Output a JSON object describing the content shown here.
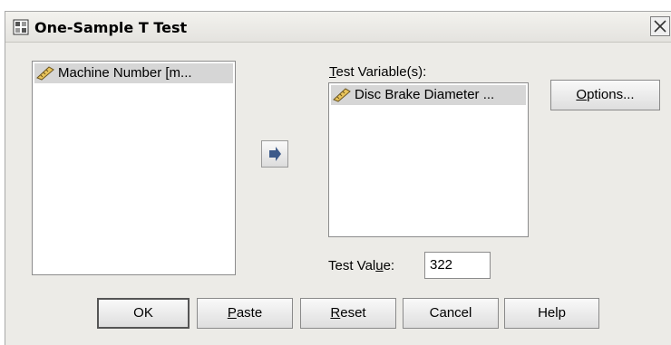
{
  "window": {
    "title": "One-Sample T Test"
  },
  "source_list": {
    "items": [
      {
        "label": "Machine Number [m...",
        "icon": "ruler-icon"
      }
    ]
  },
  "test_variables": {
    "label_before": "",
    "label_mnemonic": "T",
    "label_rest": "est Variable(s):",
    "items": [
      {
        "label": "Disc Brake Diameter ...",
        "icon": "ruler-icon"
      }
    ]
  },
  "test_value": {
    "label_before": "Test Val",
    "label_mnemonic": "u",
    "label_after": "e:",
    "value": "322"
  },
  "buttons": {
    "options": {
      "mnemonic": "O",
      "rest": "ptions..."
    },
    "ok": {
      "label": "OK"
    },
    "paste": {
      "mnemonic": "P",
      "rest": "aste"
    },
    "reset": {
      "mnemonic": "R",
      "rest": "eset"
    },
    "cancel": {
      "label": "Cancel"
    },
    "help": {
      "label": "Help"
    }
  }
}
